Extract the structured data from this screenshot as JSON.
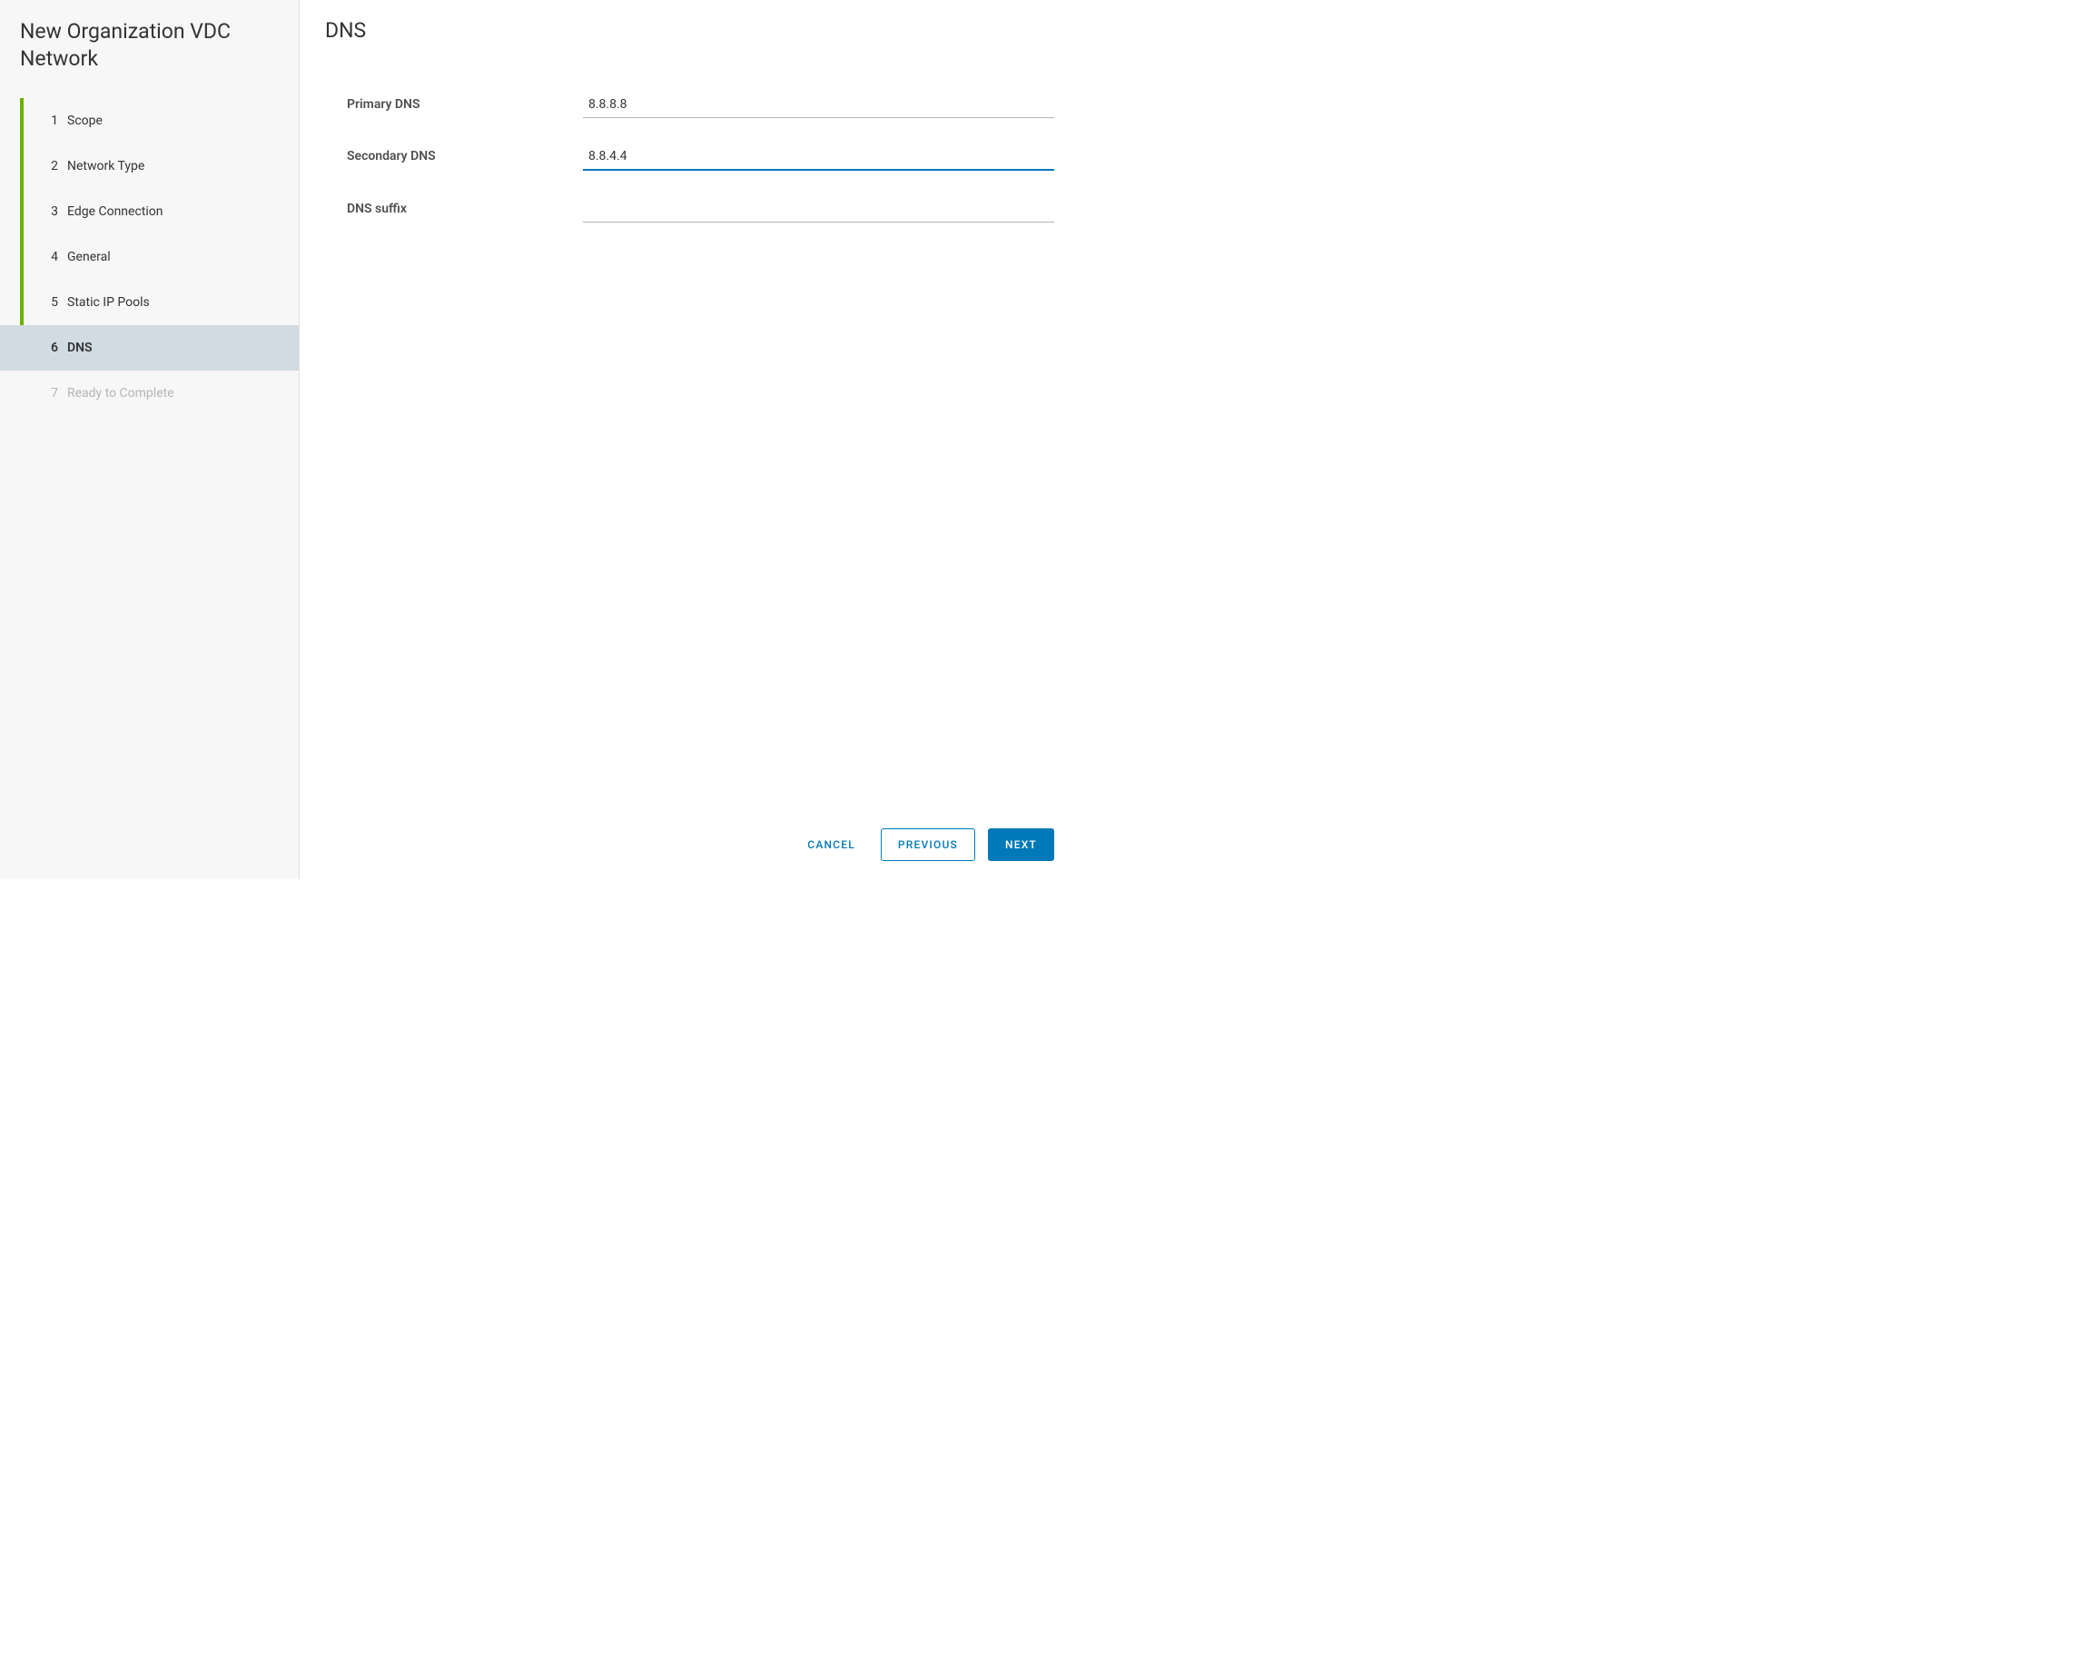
{
  "wizard": {
    "title": "New Organization VDC Network",
    "steps": [
      {
        "number": "1",
        "label": "Scope"
      },
      {
        "number": "2",
        "label": "Network Type"
      },
      {
        "number": "3",
        "label": "Edge Connection"
      },
      {
        "number": "4",
        "label": "General"
      },
      {
        "number": "5",
        "label": "Static IP Pools"
      },
      {
        "number": "6",
        "label": "DNS"
      },
      {
        "number": "7",
        "label": "Ready to Complete"
      }
    ]
  },
  "content": {
    "heading": "DNS",
    "fields": {
      "primaryDns": {
        "label": "Primary DNS",
        "value": "8.8.8.8"
      },
      "secondaryDns": {
        "label": "Secondary DNS",
        "value": "8.8.4.4"
      },
      "dnsSuffix": {
        "label": "DNS suffix",
        "value": ""
      }
    }
  },
  "footer": {
    "cancel": "CANCEL",
    "previous": "PREVIOUS",
    "next": "NEXT"
  }
}
